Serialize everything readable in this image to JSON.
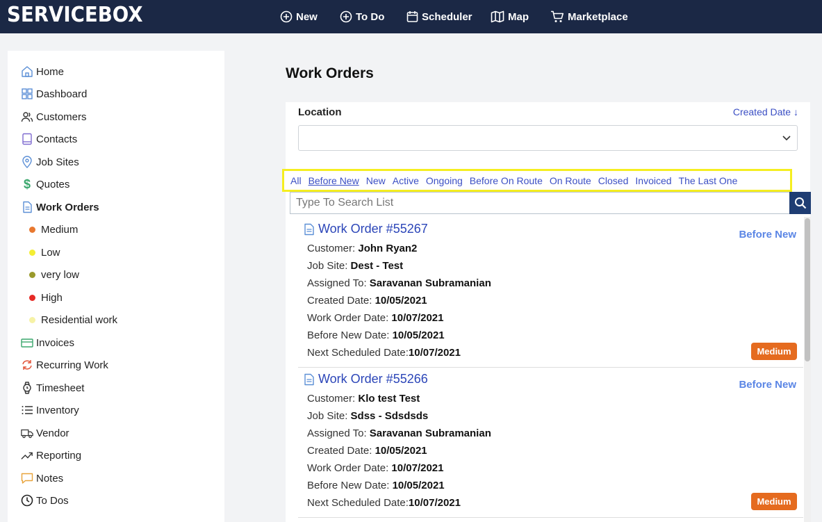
{
  "app": {
    "logo": "SERVICEBOX"
  },
  "topnav": [
    {
      "label": "New",
      "icon": "plus-circle-icon"
    },
    {
      "label": "To Do",
      "icon": "plus-circle-icon"
    },
    {
      "label": "Scheduler",
      "icon": "calendar-icon"
    },
    {
      "label": "Map",
      "icon": "map-icon"
    },
    {
      "label": "Marketplace",
      "icon": "cart-icon"
    }
  ],
  "sidebar": {
    "items": [
      {
        "label": "Home",
        "icon": "home-icon"
      },
      {
        "label": "Dashboard",
        "icon": "dashboard-icon"
      },
      {
        "label": "Customers",
        "icon": "users-icon"
      },
      {
        "label": "Contacts",
        "icon": "book-icon"
      },
      {
        "label": "Job Sites",
        "icon": "location-pin-icon"
      },
      {
        "label": "Quotes",
        "icon": "dollar-icon"
      },
      {
        "label": "Work Orders",
        "icon": "document-icon"
      },
      {
        "label": "Invoices",
        "icon": "card-icon"
      },
      {
        "label": "Recurring Work",
        "icon": "sync-icon"
      },
      {
        "label": "Timesheet",
        "icon": "watch-icon"
      },
      {
        "label": "Inventory",
        "icon": "list-icon"
      },
      {
        "label": "Vendor",
        "icon": "truck-icon"
      },
      {
        "label": "Reporting",
        "icon": "trend-icon"
      },
      {
        "label": "Notes",
        "icon": "comment-icon"
      },
      {
        "label": "To Dos",
        "icon": "clock-icon"
      }
    ],
    "work_order_priorities": [
      {
        "label": "Medium",
        "color": "#e8782f"
      },
      {
        "label": "Low",
        "color": "#f4ee33"
      },
      {
        "label": "very low",
        "color": "#9a9a2b"
      },
      {
        "label": "High",
        "color": "#e62a25"
      },
      {
        "label": "Residential work",
        "color": "#f6f2a6"
      }
    ]
  },
  "main": {
    "title": "Work Orders",
    "location_label": "Location",
    "location_value": "",
    "sort_label": "Created Date",
    "filters": [
      "All",
      "Before New",
      "New",
      "Active",
      "Ongoing",
      "Before On Route",
      "On Route",
      "Closed",
      "Invoiced",
      "The Last One"
    ],
    "selected_filter": "Before New",
    "search_placeholder": "Type To Search List",
    "work_orders": [
      {
        "title": "Work Order #55267",
        "status": "Before New",
        "fields": [
          {
            "label": "Customer: ",
            "value": "John Ryan2"
          },
          {
            "label": "Job Site: ",
            "value": "Dest - Test"
          },
          {
            "label": "Assigned To: ",
            "value": "Saravanan Subramanian"
          },
          {
            "label": "Created Date: ",
            "value": "10/05/2021"
          },
          {
            "label": "Work Order Date: ",
            "value": "10/07/2021"
          },
          {
            "label": "Before New Date: ",
            "value": "10/05/2021"
          },
          {
            "label": "Next Scheduled Date:",
            "value": "10/07/2021"
          }
        ],
        "priority": "Medium",
        "priority_color": "#e56b1f"
      },
      {
        "title": "Work Order #55266",
        "status": "Before New",
        "fields": [
          {
            "label": "Customer: ",
            "value": "Klo test Test"
          },
          {
            "label": "Job Site: ",
            "value": "Sdss - Sdsdsds"
          },
          {
            "label": "Assigned To: ",
            "value": "Saravanan Subramanian"
          },
          {
            "label": "Created Date: ",
            "value": "10/05/2021"
          },
          {
            "label": "Work Order Date: ",
            "value": "10/07/2021"
          },
          {
            "label": "Before New Date: ",
            "value": "10/05/2021"
          },
          {
            "label": "Next Scheduled Date:",
            "value": "10/07/2021"
          }
        ],
        "priority": "Medium",
        "priority_color": "#e56b1f"
      }
    ]
  },
  "colors": {
    "topbar": "#1b2845",
    "link": "#3b4fc4",
    "status": "#5b86e5",
    "filter_highlight": "#f5ee20"
  }
}
